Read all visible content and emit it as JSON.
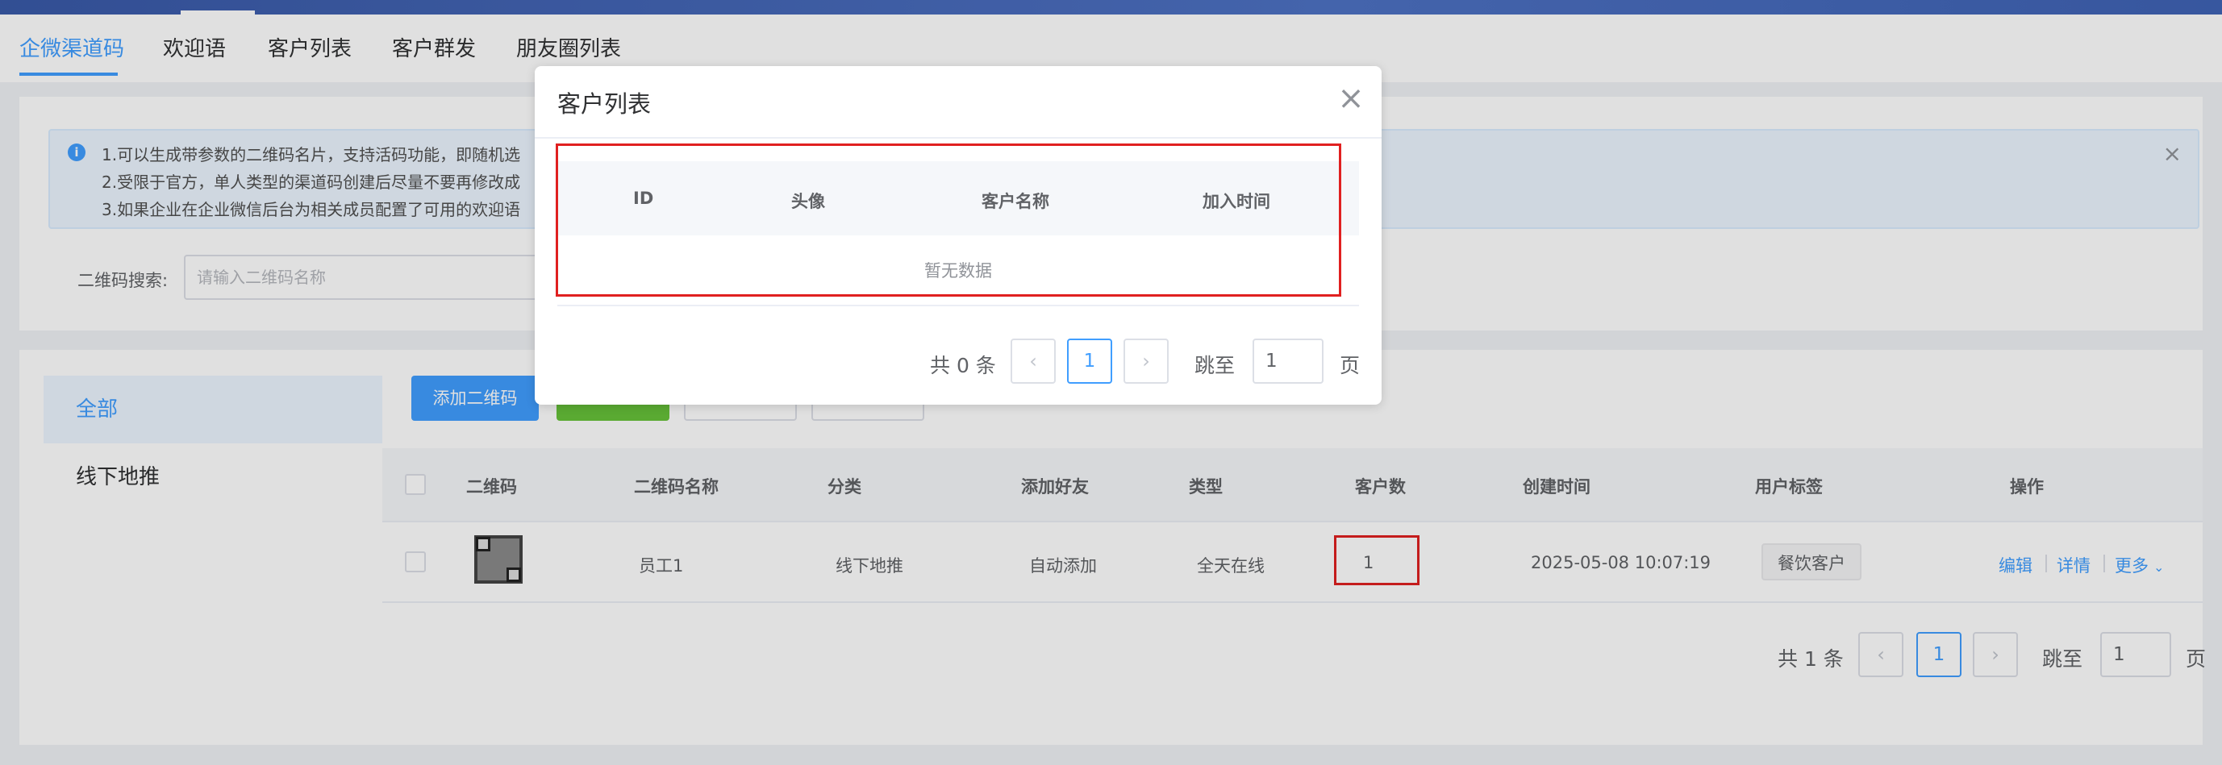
{
  "tabs": [
    {
      "label": "企微渠道码"
    },
    {
      "label": "欢迎语"
    },
    {
      "label": "客户列表"
    },
    {
      "label": "客户群发"
    },
    {
      "label": "朋友圈列表"
    }
  ],
  "alert": {
    "line1": "1.可以生成带参数的二维码名片，支持活码功能，即随机选",
    "line2": "2.受限于官方，单人类型的渠道码创建后尽量不要再修改成",
    "line3": "3.如果企业在企业微信后台为相关成员配置了可用的欢迎语"
  },
  "search": {
    "label": "二维码搜索:",
    "placeholder": "请输入二维码名称"
  },
  "sidebar": {
    "items": [
      {
        "label": "全部"
      },
      {
        "label": "线下地推"
      }
    ]
  },
  "toolbar": {
    "add_label": "添加二维码"
  },
  "colors": {
    "primary": "#409eff",
    "success": "#67c23a",
    "danger": "#e02020"
  },
  "table": {
    "headers": [
      "二维码",
      "二维码名称",
      "分类",
      "添加好友",
      "类型",
      "客户数",
      "创建时间",
      "用户标签",
      "操作"
    ],
    "rows": [
      {
        "name": "员工1",
        "category": "线下地推",
        "add_friend": "自动添加",
        "type": "全天在线",
        "customer_count": "1",
        "created": "2025-05-08 10:07:19",
        "tag": "餐饮客户",
        "actions": {
          "edit": "编辑",
          "detail": "详情",
          "more": "更多"
        }
      }
    ]
  },
  "pager": {
    "total": "共 1 条",
    "page": "1",
    "jump_label": "跳至",
    "jump_value": "1",
    "page_unit": "页"
  },
  "dialog": {
    "title": "客户列表",
    "headers": [
      "ID",
      "头像",
      "客户名称",
      "加入时间"
    ],
    "empty": "暂无数据",
    "pager": {
      "total": "共 0 条",
      "page": "1",
      "jump_label": "跳至",
      "jump_value": "1",
      "page_unit": "页"
    }
  }
}
